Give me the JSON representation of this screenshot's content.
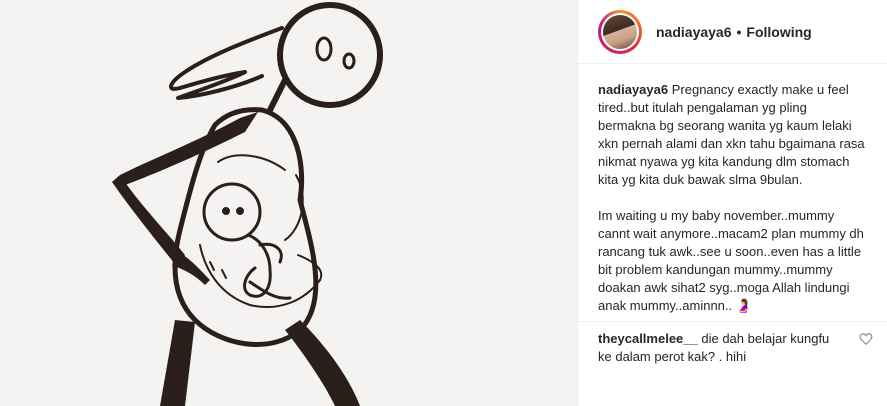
{
  "header": {
    "username": "nadiayaya6",
    "separator": "•",
    "follow_status": "Following"
  },
  "caption": {
    "username": "nadiayaya6",
    "text_part1": "Pregnancy exactly make u feel tired..but itulah pengalaman yg pling bermakna bg seorang wanita yg kaum lelaki xkn pernah alami dan xkn tahu bgaimana rasa nikmat nyawa yg kita kandung dlm stomach kita yg kita duk bawak slma 9bulan.",
    "text_part2": "Im waiting u my baby november..mummy cannt wait anymore..macam2 plan mummy dh rancang tuk awk..see u soon..even has a little bit problem kandungan mummy..mummy doakan awk sihat2 syg..moga Allah lindungi anak mummy..aminnn..",
    "emoji": "🤰"
  },
  "comments": [
    {
      "username": "theycallmelee__",
      "text": "die dah belajar kungfu ke dalam perot kak? . hihi"
    }
  ],
  "icons": {
    "like": "heart-icon",
    "emoji": "pregnant-woman-icon"
  },
  "colors": {
    "text": "#262626",
    "border": "#efefef",
    "image_bg": "#f4f3f1",
    "ink": "#2a1f1a"
  }
}
